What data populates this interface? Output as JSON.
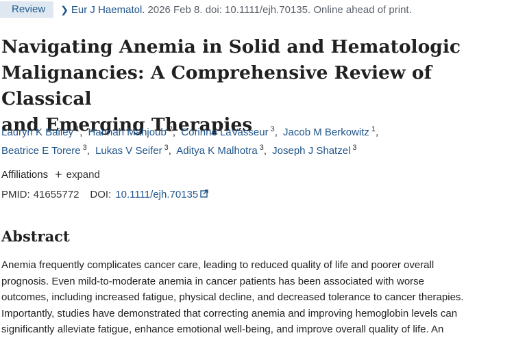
{
  "badge": "Review",
  "citation": {
    "journal": "Eur J Haematol.",
    "details": "2026 Feb 8. doi: 10.1111/ejh.70135. Online ahead of print."
  },
  "title_lines": [
    "Navigating Anemia in Solid and Hematologic",
    "Malignancies: A Comprehensive Review of Classical",
    "and Emerging Therapies"
  ],
  "authors": [
    {
      "name": "Lauryn K Bailey",
      "aff": "1"
    },
    {
      "name": "Hannah Mahjoub",
      "aff": "2"
    },
    {
      "name": "Corinne LaVasseur",
      "aff": "3"
    },
    {
      "name": "Jacob M Berkowitz",
      "aff": "1"
    },
    {
      "name": "Beatrice E Torere",
      "aff": "3"
    },
    {
      "name": "Lukas V Seifer",
      "aff": "3"
    },
    {
      "name": "Aditya K Malhotra",
      "aff": "3"
    },
    {
      "name": "Joseph J Shatzel",
      "aff": "3"
    }
  ],
  "affiliations": {
    "label": "Affiliations",
    "expand": "expand"
  },
  "ids": {
    "pmid_label": "PMID:",
    "pmid": "41655772",
    "doi_label": "DOI:",
    "doi": "10.1111/ejh.70135"
  },
  "abstract": {
    "heading": "Abstract",
    "lines": [
      "Anemia frequently complicates cancer care, leading to reduced quality of life and poorer overall",
      "prognosis. Even mild-to-moderate anemia in cancer patients has been associated with worse",
      "outcomes, including increased fatigue, physical decline, and decreased tolerance to cancer therapies.",
      "Importantly, studies have demonstrated that correcting anemia and improving hemoglobin levels can",
      "significantly alleviate fatigue, enhance emotional well-being, and improve overall quality of life. An"
    ]
  },
  "colors": {
    "link": "#20558a",
    "badge_bg": "#dfe8f1"
  }
}
